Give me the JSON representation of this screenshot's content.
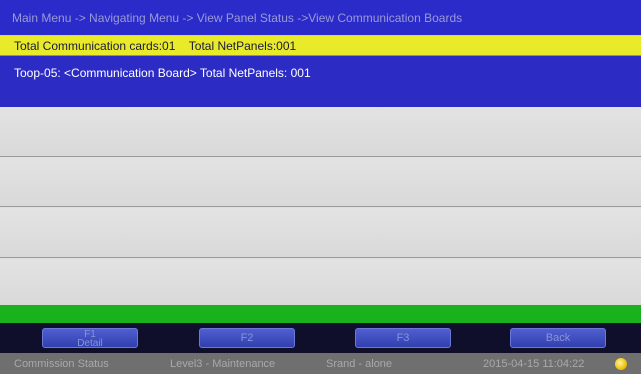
{
  "breadcrumb": "Main Menu -> Navigating Menu -> View Panel Status ->View Communication Boards",
  "summary": {
    "cards": "Total Communication cards:01",
    "netpanels": "Total NetPanels:001"
  },
  "selected_row": "Toop-05: <Communication Board> Total NetPanels: 001",
  "function_keys": {
    "f1_top": "F1",
    "f1_bottom": "Detail",
    "f2": "F2",
    "f3": "F3",
    "back": "Back"
  },
  "status_bar": {
    "mode": "Commission Status",
    "level": "Level3 - Maintenance",
    "network": "Srand - alone",
    "datetime": "2015-04-15 11:04:22"
  },
  "colors": {
    "header_blue": "#2b2bc9",
    "summary_yellow": "#e8ea2a",
    "selection_blue": "#2c2cc4",
    "status_green": "#19b21c",
    "lamp_yellow": "#f0c20a"
  }
}
